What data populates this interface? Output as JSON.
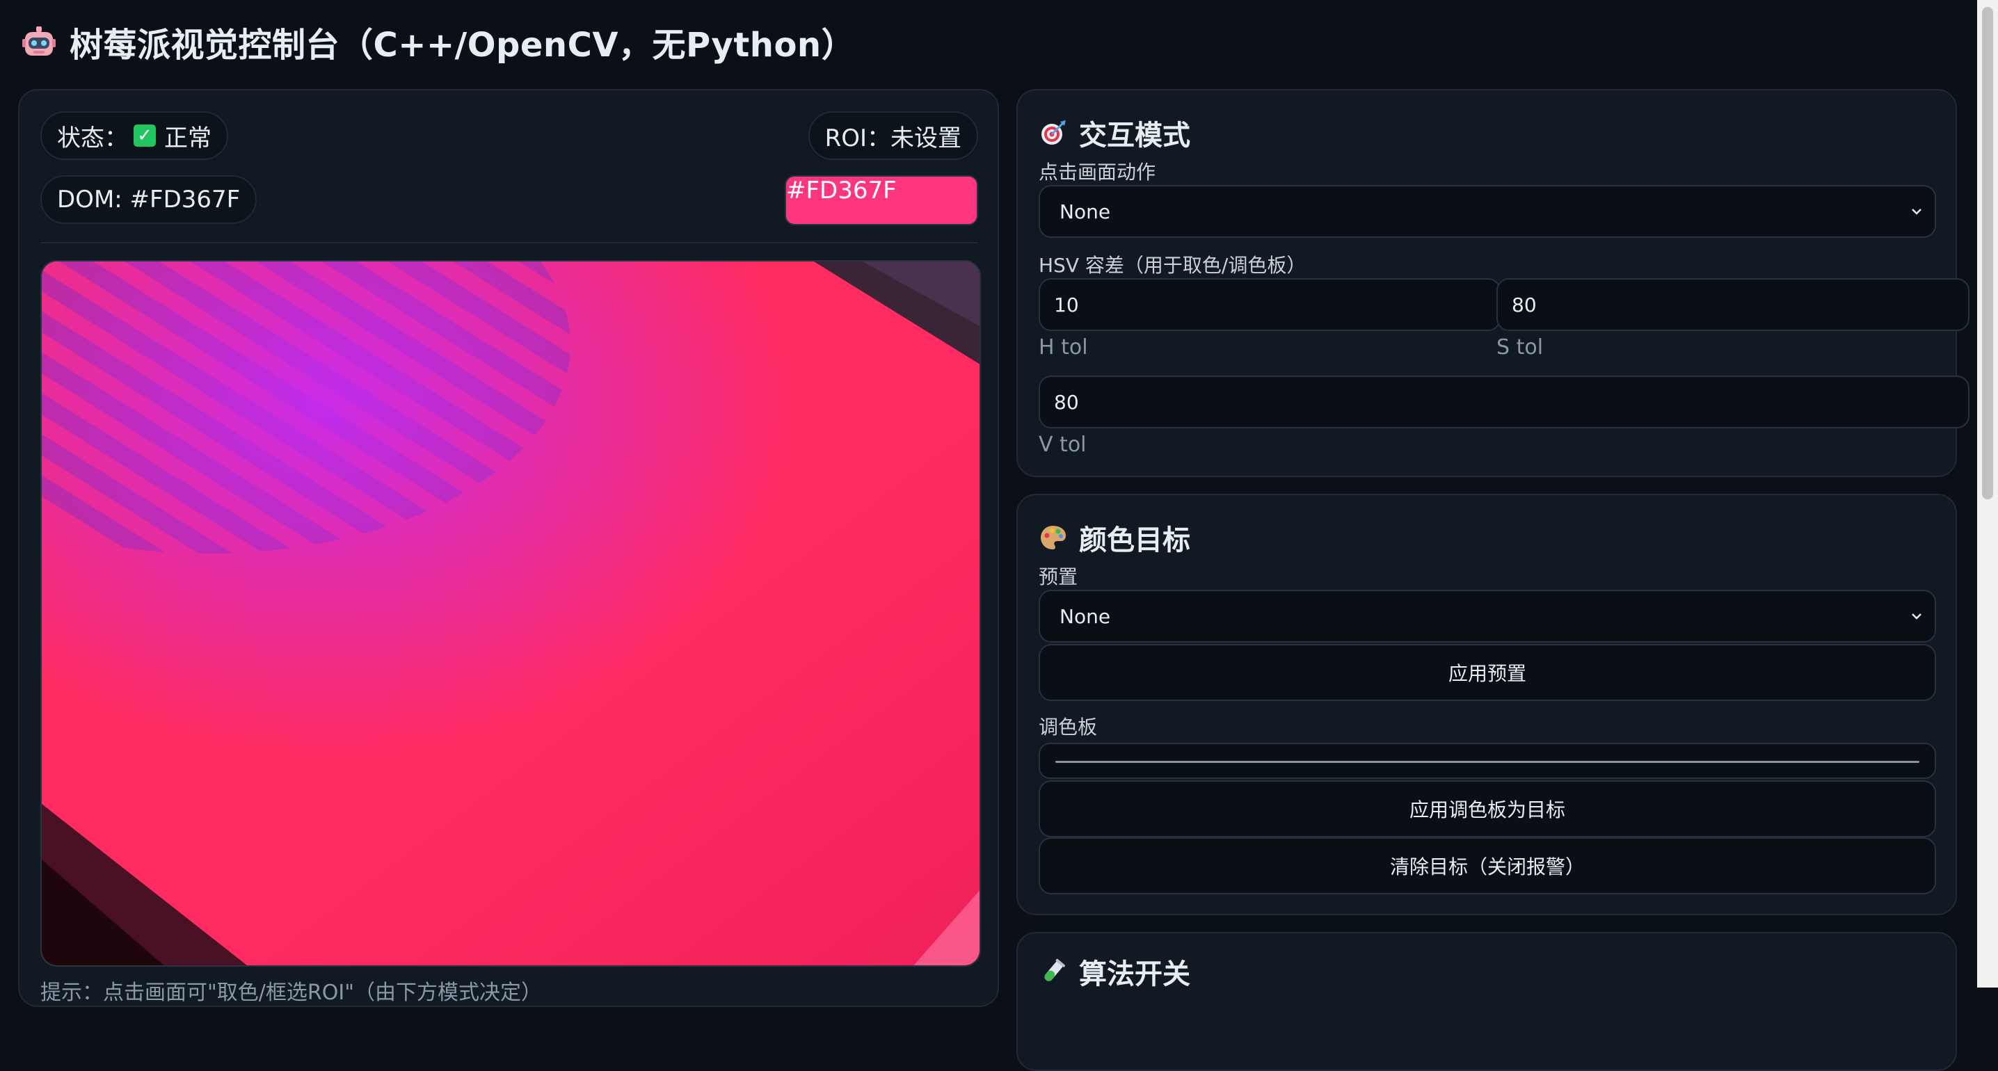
{
  "header": {
    "title": "树莓派视觉控制台（C++/OpenCV，无Python）",
    "icon": "robot-icon"
  },
  "left": {
    "status_label": "状态：",
    "status_value": "正常",
    "roi_label": "ROI：未设置",
    "dom_label": "DOM: #FD367F",
    "swatch_color": "#FD367F",
    "swatch_text": "#FD367F",
    "hint": "提示：点击画面可\"取色/框选ROI\"（由下方模式决定）"
  },
  "interaction": {
    "title": "交互模式",
    "icon": "target-icon",
    "click_action_label": "点击画面动作",
    "click_action_value": "None",
    "hsv_label": "HSV 容差（用于取色/调色板）",
    "h_tol": "10",
    "s_tol": "80",
    "v_tol": "80",
    "h_tol_label": "H tol",
    "s_tol_label": "S tol",
    "v_tol_label": "V tol"
  },
  "color_target": {
    "title": "颜色目标",
    "icon": "palette-icon",
    "preset_label": "预置",
    "preset_value": "None",
    "apply_preset": "应用预置",
    "palette_label": "调色板",
    "apply_palette": "应用调色板为目标",
    "clear_target": "清除目标（关闭报警）"
  },
  "algorithms": {
    "title": "算法开关",
    "icon": "test-tube-icon"
  }
}
